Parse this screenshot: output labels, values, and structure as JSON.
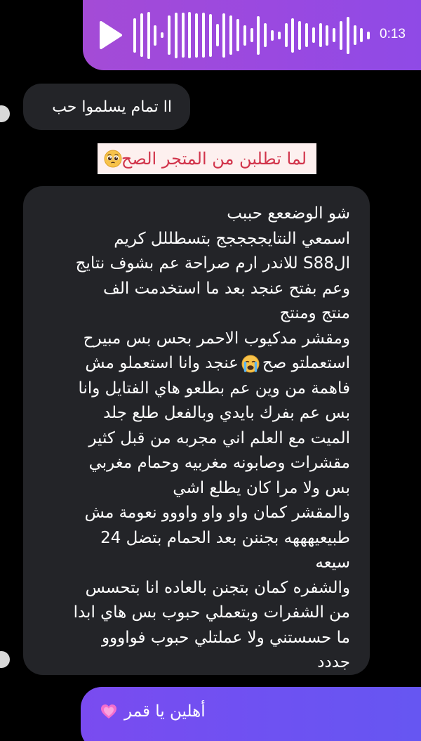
{
  "voice_message": {
    "duration": "0:13",
    "icon": "play-icon",
    "waveform_levels": [
      0.7,
      0.88,
      0.95,
      0.42,
      0.12,
      0.8,
      0.93,
      0.92,
      0.94,
      0.9,
      0.92,
      0.87,
      0.45,
      0.9,
      0.8,
      0.65,
      0.42,
      0.28,
      0.78,
      0.48,
      0.22,
      0.15,
      0.48,
      0.7,
      0.58,
      0.48,
      0.32,
      0.48,
      0.42,
      0.28,
      0.58,
      0.75,
      0.4,
      0.28,
      0.15
    ],
    "color": "#9a49e0"
  },
  "messages": {
    "reply_short": "اا تمام يسلموا حب",
    "caption": "لما تطلبن من المتجر الصح :",
    "caption_emoji": "pleading-face-emoji",
    "review_lines": [
      "شو الوضععع حببب",
      "اسمعي النتايججججج بتسطللل كريم",
      "الS88 للاندر ارم صراحة عم بشوف نتايج",
      "وعم بفتح عنجد بعد ما استخدمت الف",
      "منتج ومنتج",
      "ومقشر مدكيوب الاحمر بحس بس مبيرح",
      "استعملتو صح",
      "عنجد وانا استعملو مش",
      "فاهمة من وين عم بطلعو هاي الفتايل وانا",
      "بس عم بفرك بايدي وبالفعل طلع جلد",
      "الميت مع العلم اني مجربه من قبل كثير",
      "مقشرات وصابونه مغربيه وحمام مغربي",
      "بس ولا مرا كان يطلع اشي",
      "والمقشر كمان واو واو واووو نعومة مش",
      "طبيعيهههه بجننن بعد الحمام بتضل 24",
      "سيعه",
      "والشفره كمان بتجنن بالعاده انا بتحسس",
      "من الشفرات وبتعملي حبوب بس هاي ابدا",
      "ما حسستني ولا عملتلي حبوب فواووو",
      "جددد"
    ],
    "review_emoji": "crying-face-emoji",
    "outgoing": "أهلين يا قمر",
    "outgoing_emoji": "heart-icon"
  },
  "colors": {
    "background": "#000000",
    "incoming_bubble": "#232428",
    "outgoing_bubble": "#6d52f2",
    "caption_text": "#d1334a",
    "caption_background": "#fdf0ef"
  }
}
